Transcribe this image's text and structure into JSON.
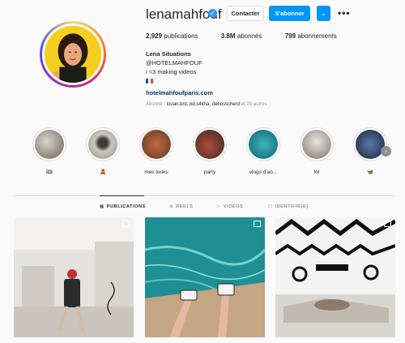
{
  "profile": {
    "username": "lenamahfouf",
    "verified_mark": "✓",
    "contact_label": "Contacter",
    "follow_label": "S'abonner",
    "suggest_label": "⌄",
    "more_label": "•••",
    "stats": {
      "posts_value": "2,929",
      "posts_label": "publications",
      "followers_value": "3.8M",
      "followers_label": "abonnés",
      "following_value": "799",
      "following_label": "abonnements"
    },
    "bio": {
      "name": "Lena Situations",
      "line1": "@HOTELMAHFOUF",
      "line2": "i <3 making videos",
      "website": "hotelmahfoufparis.com"
    },
    "followed_by_prefix": "Abonné : ",
    "followed_by_names": "louan.brd, bd.s4kha, debosscherd",
    "followed_by_suffix": " et 20 autres"
  },
  "highlights": [
    {
      "label": "🎟"
    },
    {
      "label": "🧸"
    },
    {
      "label": "mes looks"
    },
    {
      "label": "party"
    },
    {
      "label": "vlogs d'ao..."
    },
    {
      "label": "lol"
    },
    {
      "label": "🦋"
    }
  ],
  "tabs": [
    {
      "label": "PUBLICATIONS",
      "icon": "▦"
    },
    {
      "label": "REELS",
      "icon": "⊙"
    },
    {
      "label": "VIDÉOS",
      "icon": "▷"
    },
    {
      "label": "IDENTIFIÉ(E)",
      "icon": "☐"
    }
  ],
  "icons": {
    "verified": "verified-badge-icon",
    "next": "chevron-right-icon"
  },
  "colors": {
    "follow_blue": "#0095f6",
    "link_blue": "#00376b",
    "verified_blue": "#3897f0"
  }
}
